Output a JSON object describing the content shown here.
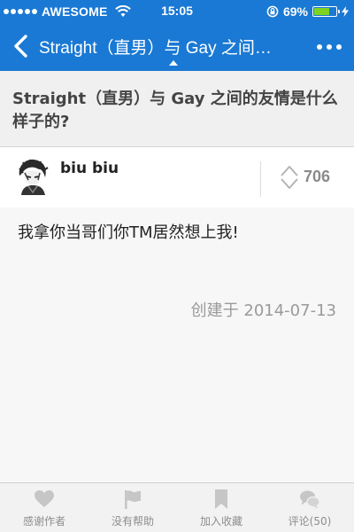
{
  "status_bar": {
    "carrier": "AWESOME",
    "time": "15:05",
    "battery_percent": "69%",
    "battery_level": 0.69
  },
  "nav": {
    "title": "Straight（直男）与 Gay 之间…"
  },
  "question": {
    "title": "Straight（直男）与 Gay 之间的友情是什么样子的?"
  },
  "answer": {
    "author": "biu biu",
    "votes": "706",
    "content": "我拿你当哥们你TM居然想上我!",
    "created": "创建于 2014-07-13"
  },
  "toolbar": {
    "thank": "感谢作者",
    "unhelpful": "没有帮助",
    "collect": "加入收藏",
    "comments": "评论(50)"
  },
  "colors": {
    "header_blue": "#1a79d4",
    "battery_green": "#7ed321"
  },
  "icons": [
    "wifi-icon",
    "orientation-lock-icon",
    "battery-icon",
    "charging-bolt-icon",
    "back-chevron-icon",
    "more-dots-icon",
    "vote-arrows-icon",
    "heart-icon",
    "flag-icon",
    "bookmark-icon",
    "comment-icon"
  ]
}
